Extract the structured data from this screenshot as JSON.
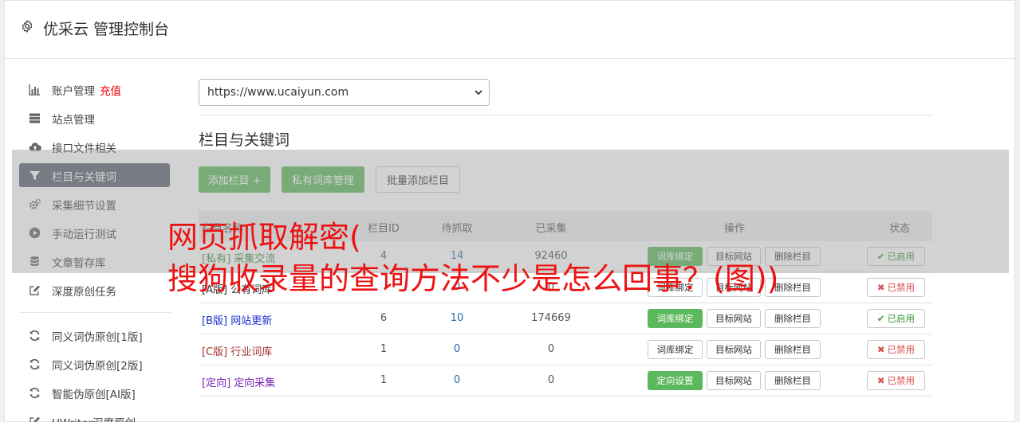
{
  "header": {
    "title": "优采云 管理控制台",
    "icon": "gear-icon"
  },
  "sidebar": {
    "items": [
      {
        "label": "账户管理",
        "extra": "充值",
        "icon": "bar-chart-icon"
      },
      {
        "label": "站点管理",
        "icon": "server-icon"
      },
      {
        "label": "接口文件相关",
        "icon": "cloud-upload-icon"
      },
      {
        "label": "栏目与关键词",
        "icon": "filter-icon",
        "active": true
      },
      {
        "label": "采集细节设置",
        "icon": "cogs-icon"
      },
      {
        "label": "手动运行测试",
        "icon": "play-icon"
      },
      {
        "label": "文章暂存库",
        "icon": "database-icon"
      },
      {
        "label": "深度原创任务",
        "icon": "edit-icon"
      }
    ],
    "items2": [
      {
        "label": "同义词伪原创[1版]",
        "icon": "refresh-icon"
      },
      {
        "label": "同义词伪原创[2版]",
        "icon": "refresh-icon"
      },
      {
        "label": "智能伪原创[AI版]",
        "icon": "refresh-icon"
      },
      {
        "label": "UWriter深度原创",
        "icon": "edit-icon"
      }
    ]
  },
  "site_select": {
    "value": "https://www.ucaiyun.com"
  },
  "section_title": "栏目与关键词",
  "toolbar": {
    "add_column": "添加栏目 +",
    "private_lib": "私有词库管理",
    "batch_add": "批量添加栏目"
  },
  "table": {
    "headers": {
      "name": "栏目名称",
      "id": "栏目ID",
      "pending": "待抓取",
      "collected": "已采集",
      "ops": "操作",
      "status": "状态"
    },
    "rows": [
      {
        "tag": "[私有]",
        "name": "采集交流",
        "id": "4",
        "pending": "14",
        "collected": "92460",
        "op1": "词库绑定",
        "op2": "目标网站",
        "op3": "删除栏目",
        "status": "已启用",
        "color": "#3c8f3c"
      },
      {
        "tag": "[A版]",
        "name": "公有词库",
        "id": "",
        "pending": "0",
        "collected": "0",
        "op1": "词库绑定",
        "op2": "目标网站",
        "op3": "删除栏目",
        "status": "已禁用",
        "color": "#333333"
      },
      {
        "tag": "[B版]",
        "name": "网站更新",
        "id": "6",
        "pending": "10",
        "collected": "174669",
        "op1": "词库绑定",
        "op2": "目标网站",
        "op3": "删除栏目",
        "status": "已启用",
        "color": "#1a2fcc"
      },
      {
        "tag": "[C版]",
        "name": "行业词库",
        "id": "1",
        "pending": "0",
        "collected": "0",
        "op1": "词库绑定",
        "op2": "目标网站",
        "op3": "删除栏目",
        "status": "已禁用",
        "color": "#a3322f"
      },
      {
        "tag": "[定向]",
        "name": "定向采集",
        "id": "1",
        "pending": "0",
        "collected": "0",
        "op1": "定向设置",
        "op2": "目标网站",
        "op3": "删除栏目",
        "status": "已禁用",
        "color": "#7a22b8"
      }
    ]
  },
  "overlay": {
    "line1": "网页抓取解密(",
    "line2": "搜狗收录量的查询方法不少是怎么回事？(图))"
  },
  "colors": {
    "accent_green": "#5cb85c",
    "active_sidebar": "#5a6270",
    "caption_red": "#ee1111",
    "recharge_red": "#ee0000"
  }
}
